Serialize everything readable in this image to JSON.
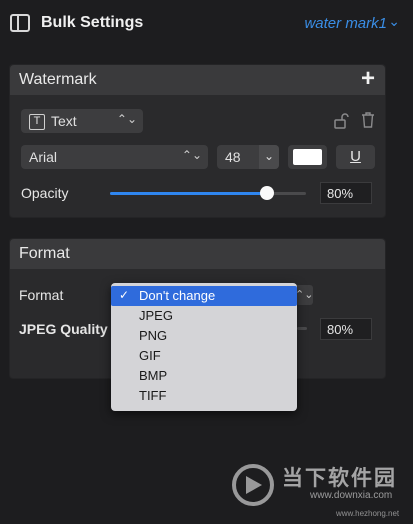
{
  "header": {
    "title": "Bulk Settings",
    "preset": "water mark1",
    "preset_chevron": "⌄"
  },
  "watermark_panel": {
    "title": "Watermark",
    "add_label": "+",
    "type_select": "Text",
    "font_select": "Arial",
    "font_size": "48",
    "underline_label": "U",
    "opacity_label": "Opacity",
    "opacity_value": "80%",
    "opacity_fraction": 0.8,
    "text_color": "#ffffff"
  },
  "format_panel": {
    "title": "Format",
    "format_label": "Format",
    "jpeg_quality_label": "JPEG Quality",
    "jpeg_quality_value": "80%"
  },
  "format_dropdown": {
    "options": [
      "Don't change",
      "JPEG",
      "PNG",
      "GIF",
      "BMP",
      "TIFF"
    ],
    "selected_index": 0,
    "check": "✓"
  },
  "site_watermark": {
    "name": "当下软件园",
    "url": "www.downxia.com",
    "footer": "www.hezhong.net"
  },
  "colors": {
    "accent": "#2f86f0",
    "preset_text": "#3a8ee6",
    "selection": "#2f6bdc"
  }
}
